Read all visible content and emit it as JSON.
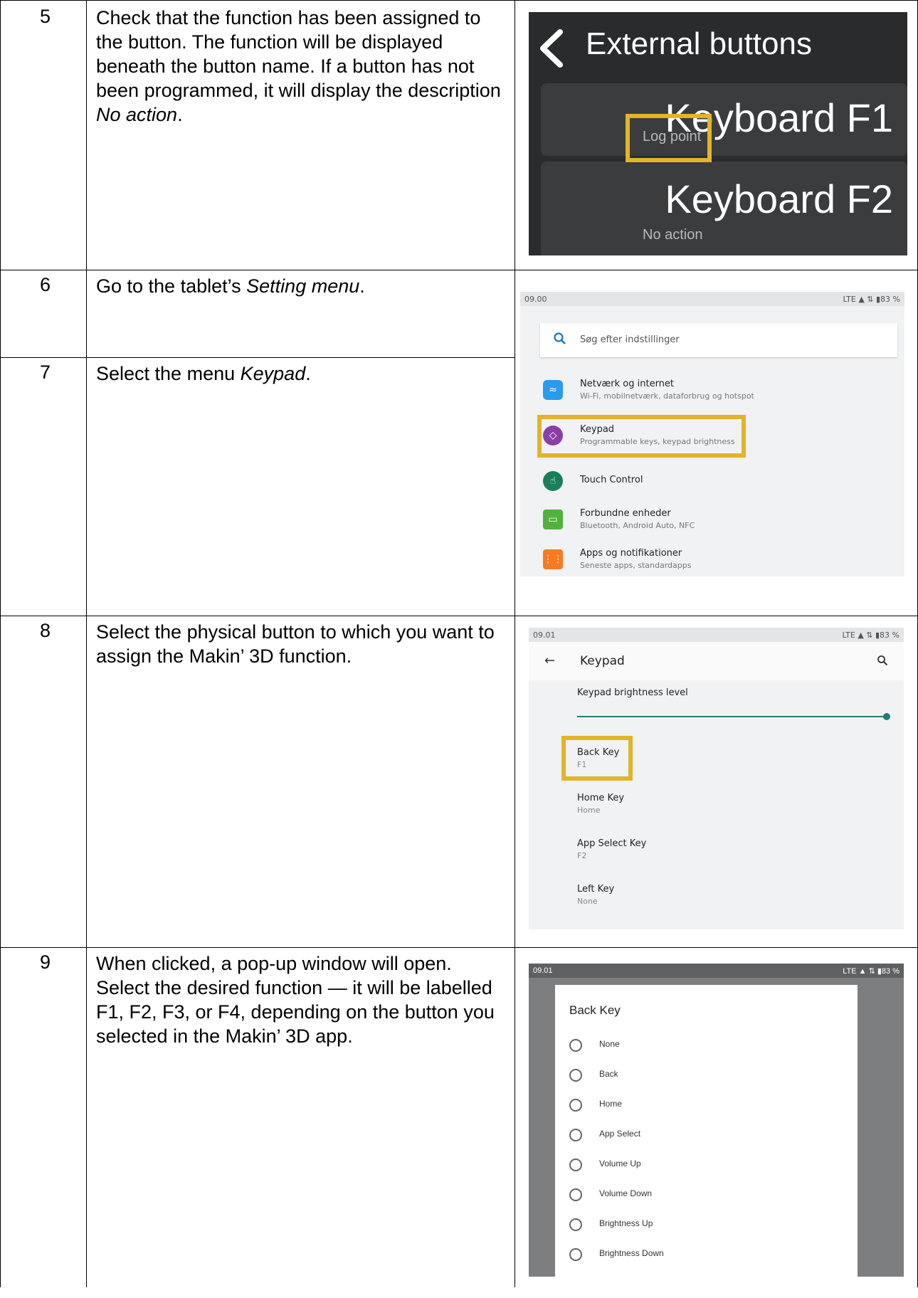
{
  "steps": [
    {
      "number": "5",
      "text": "Check that the function has been assigned to the button. The function will be displayed beneath the button name. If a button has not been programmed, it will display the description",
      "text_italic": "No action",
      "text_end": "."
    },
    {
      "number": "6",
      "text": "Go to the tablet’s",
      "text_italic": "Setting menu",
      "text_end": "."
    },
    {
      "number": "7",
      "text": "Select the menu",
      "text_italic": "Keypad",
      "text_end": "."
    },
    {
      "number": "8",
      "text": "Select the physical button to which you want to assign the Makin’ 3D function."
    },
    {
      "number": "9",
      "text": "When clicked, a pop-up window will open. Select the desired function — it will be labelled F1, F2, F3, or F4, depending on the button you selected in the Makin’ 3D app."
    }
  ],
  "external_buttons": {
    "title": "External buttons",
    "buttons": [
      {
        "name": "Keyboard F1",
        "function": "Log point"
      },
      {
        "name": "Keyboard F2",
        "function": "No action"
      }
    ]
  },
  "highlight_color": "#e1b42a",
  "settings": {
    "time": "09.00",
    "status_icons": "LTE ▲ ⇅ ▮83 %",
    "search_placeholder": "Søg efter indstillinger",
    "items": [
      {
        "icon": "wifi-icon",
        "color": "#2a9bf0",
        "title": "Netværk og internet",
        "subtitle": "Wi-Fi, mobilnetværk, dataforbrug og hotspot"
      },
      {
        "icon": "keypad-icon",
        "color": "#8a3fa8",
        "title": "Keypad",
        "subtitle": "Programmable keys, keypad brightness"
      },
      {
        "icon": "touch-icon",
        "color": "#197e5a",
        "title": "Touch Control",
        "subtitle": ""
      },
      {
        "icon": "devices-icon",
        "color": "#52b03e",
        "title": "Forbundne enheder",
        "subtitle": "Bluetooth, Android Auto, NFC"
      },
      {
        "icon": "apps-icon",
        "color": "#f57c22",
        "title": "Apps og notifikationer",
        "subtitle": "Seneste apps, standardapps"
      }
    ]
  },
  "keypad": {
    "time": "09.01",
    "status_icons": "LTE ▲ ⇅ ▮83 %",
    "title": "Keypad",
    "brightness_label": "Keypad brightness level",
    "brightness_value": 1.0,
    "keys": [
      {
        "title": "Back Key",
        "value": "F1"
      },
      {
        "title": "Home Key",
        "value": "Home"
      },
      {
        "title": "App Select Key",
        "value": "F2"
      },
      {
        "title": "Left Key",
        "value": "None"
      }
    ]
  },
  "dialog": {
    "time": "09.01",
    "status_icons": "LTE ▲ ⇅ ▮83 %",
    "title": "Back Key",
    "options": [
      "None",
      "Back",
      "Home",
      "App Select",
      "Volume Up",
      "Volume Down",
      "Brightness Up",
      "Brightness Down"
    ]
  }
}
